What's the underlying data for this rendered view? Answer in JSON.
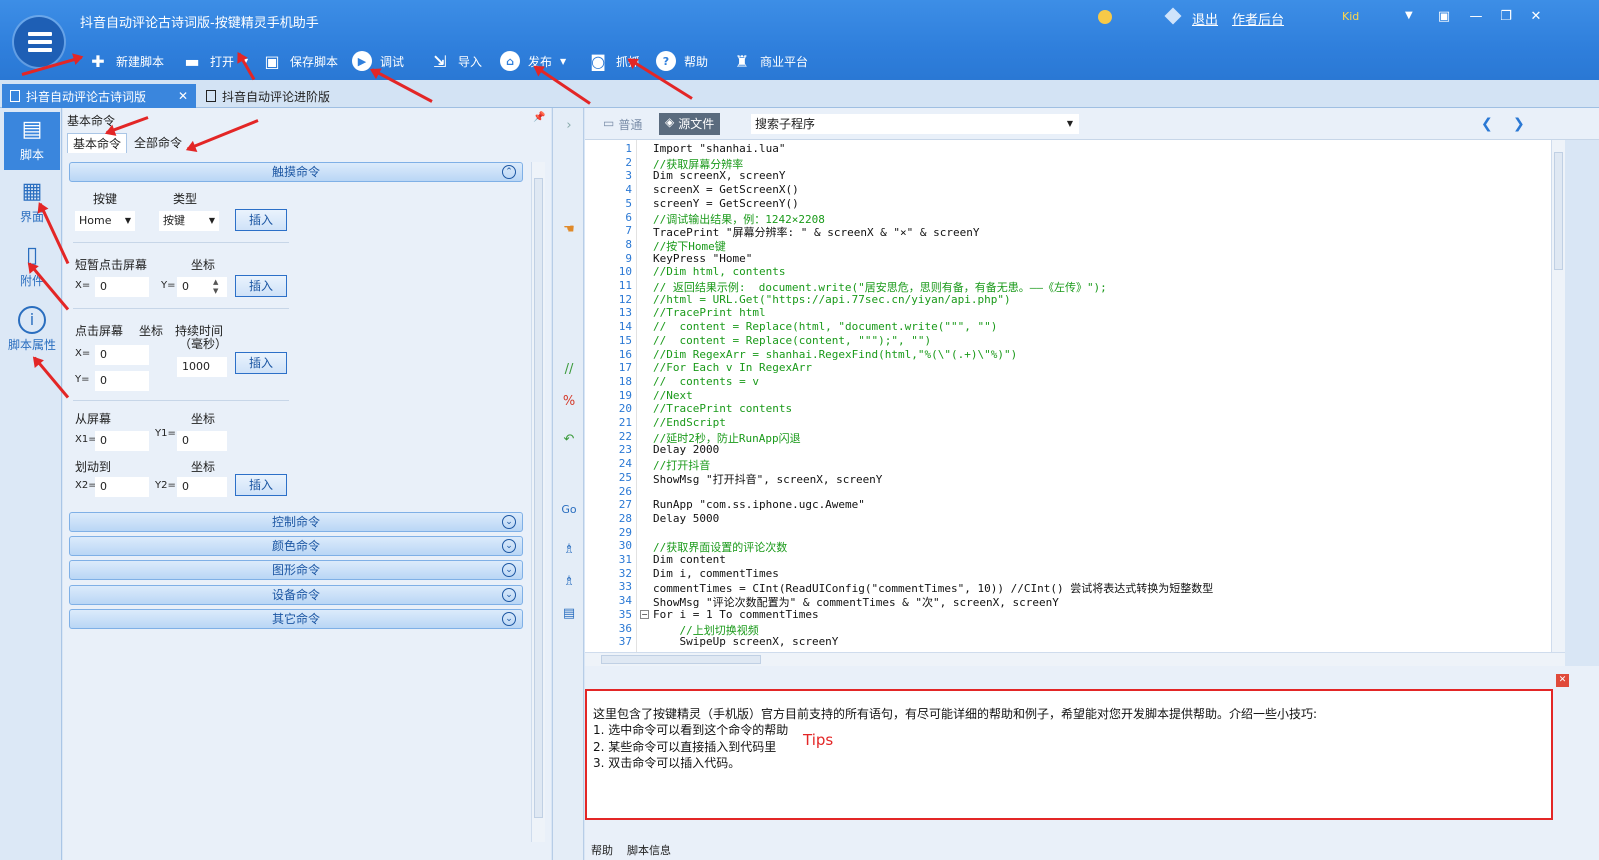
{
  "window": {
    "title": "抖音自动评论古诗词版-按键精灵手机助手"
  },
  "header": {
    "logout": "退出",
    "author_backend": "作者后台",
    "user_badge": "Kid"
  },
  "toolbar": {
    "new_script": "新建脚本",
    "open": "打开",
    "save_script": "保存脚本",
    "debug": "调试",
    "import": "导入",
    "publish": "发布",
    "capture": "抓抓",
    "help": "帮助",
    "business_platform": "商业平台"
  },
  "tabs": [
    {
      "label": "抖音自动评论古诗词版",
      "active": true
    },
    {
      "label": "抖音自动评论进阶版",
      "active": false
    }
  ],
  "leftnav": [
    {
      "label": "脚本",
      "icon": "script-icon",
      "active": true
    },
    {
      "label": "界面",
      "icon": "grid-icon",
      "active": false
    },
    {
      "label": "附件",
      "icon": "attachment-icon",
      "active": false
    },
    {
      "label": "脚本属性",
      "icon": "info-icon",
      "active": false
    }
  ],
  "commands": {
    "panel_title": "基本命令",
    "subtabs": [
      "基本命令",
      "全部命令"
    ],
    "touch_category": "触摸命令",
    "key_label": "按键",
    "type_label": "类型",
    "key_value": "Home",
    "type_value": "按键",
    "insert": "插入",
    "tap_label": "短暂点击屏幕",
    "coord_label": "坐标",
    "x_label": "X=",
    "y_label": "Y=",
    "tap_x": "0",
    "tap_y": "0",
    "press_label": "点击屏幕",
    "duration_label": "持续时间",
    "duration_unit": "（毫秒）",
    "press_x": "0",
    "press_y": "0",
    "duration_value": "1000",
    "from_label": "从屏幕",
    "to_label": "划动到",
    "x1_label": "X1=",
    "y1_label": "Y1=",
    "x2_label": "X2=",
    "y2_label": "Y2=",
    "x1": "0",
    "y1": "0",
    "x2": "0",
    "y2": "0",
    "categories": [
      "控制命令",
      "颜色命令",
      "图形命令",
      "设备命令",
      "其它命令"
    ]
  },
  "editor": {
    "mode_normal": "普通",
    "mode_source": "源文件",
    "subroutine_search": "搜索子程序",
    "lines": [
      {
        "n": "1",
        "t": "Import \"shanhai.lua\"",
        "c": false
      },
      {
        "n": "2",
        "t": "//获取屏幕分辨率",
        "c": true
      },
      {
        "n": "3",
        "t": "Dim screenX, screenY",
        "c": false
      },
      {
        "n": "4",
        "t": "screenX = GetScreenX()",
        "c": false
      },
      {
        "n": "5",
        "t": "screenY = GetScreenY()",
        "c": false
      },
      {
        "n": "6",
        "t": "//调试输出结果，例：1242×2208",
        "c": true
      },
      {
        "n": "7",
        "t": "TracePrint \"屏幕分辨率: \" & screenX & \"×\" & screenY",
        "c": false
      },
      {
        "n": "8",
        "t": "//按下Home键",
        "c": true
      },
      {
        "n": "9",
        "t": "KeyPress \"Home\"",
        "c": false
      },
      {
        "n": "10",
        "t": "//Dim html, contents",
        "c": true
      },
      {
        "n": "11",
        "t": "// 返回结果示例:  document.write(\"居安思危，思则有备，有备无患。——《左传》\");",
        "c": true
      },
      {
        "n": "12",
        "t": "//html = URL.Get(\"https://api.77sec.cn/yiyan/api.php\")",
        "c": true
      },
      {
        "n": "13",
        "t": "//TracePrint html",
        "c": true
      },
      {
        "n": "14",
        "t": "//  content = Replace(html, \"document.write(\"\"\", \"\")",
        "c": true
      },
      {
        "n": "15",
        "t": "//  content = Replace(content, \"\"\");\", \"\")",
        "c": true
      },
      {
        "n": "16",
        "t": "//Dim RegexArr = shanhai.RegexFind(html,\"%(\\\"(.+)\\\"%)\")",
        "c": true
      },
      {
        "n": "17",
        "t": "//For Each v In RegexArr",
        "c": true
      },
      {
        "n": "18",
        "t": "//  contents = v",
        "c": true
      },
      {
        "n": "19",
        "t": "//Next",
        "c": true
      },
      {
        "n": "20",
        "t": "//TracePrint contents",
        "c": true
      },
      {
        "n": "21",
        "t": "//EndScript",
        "c": true
      },
      {
        "n": "22",
        "t": "//延时2秒，防止RunApp闪退",
        "c": true
      },
      {
        "n": "23",
        "t": "Delay 2000",
        "c": false
      },
      {
        "n": "24",
        "t": "//打开抖音",
        "c": true
      },
      {
        "n": "25",
        "t": "ShowMsg \"打开抖音\", screenX, screenY",
        "c": false
      },
      {
        "n": "26",
        "t": "",
        "c": false
      },
      {
        "n": "27",
        "t": "RunApp \"com.ss.iphone.ugc.Aweme\"",
        "c": false
      },
      {
        "n": "28",
        "t": "Delay 5000",
        "c": false
      },
      {
        "n": "29",
        "t": "",
        "c": false
      },
      {
        "n": "30",
        "t": "//获取界面设置的评论次数",
        "c": true
      },
      {
        "n": "31",
        "t": "Dim content",
        "c": false
      },
      {
        "n": "32",
        "t": "Dim i, commentTimes",
        "c": false
      },
      {
        "n": "33",
        "t": "commentTimes = CInt(ReadUIConfig(\"commentTimes\", 10)) //CInt() 尝试将表达式转换为短整数型",
        "c": false
      },
      {
        "n": "34",
        "t": "ShowMsg \"评论次数配置为\" & commentTimes & \"次\", screenX, screenY",
        "c": false
      },
      {
        "n": "35",
        "t": "For i = 1 To commentTimes",
        "c": false
      },
      {
        "n": "36",
        "t": "    //上划切换视频",
        "c": true
      },
      {
        "n": "37",
        "t": "    SwipeUp screenX, screenY",
        "c": false
      }
    ]
  },
  "help": {
    "line1": "这里包含了按键精灵（手机版）官方目前支持的所有语句，有尽可能详细的帮助和例子，希望能对您开发脚本提供帮助。介绍一些小技巧:",
    "line2": "1. 选中命令可以看到这个命令的帮助",
    "line3": "2. 某些命令可以直接插入到代码里",
    "line4": "3. 双击命令可以插入代码。",
    "tips": "Tips",
    "tab_help": "帮助",
    "tab_info": "脚本信息"
  },
  "colors": {
    "accent": "#2f7fdc",
    "annotation": "#e32626",
    "comment": "#1a9a1a",
    "keyword": "#1f4fd6"
  }
}
